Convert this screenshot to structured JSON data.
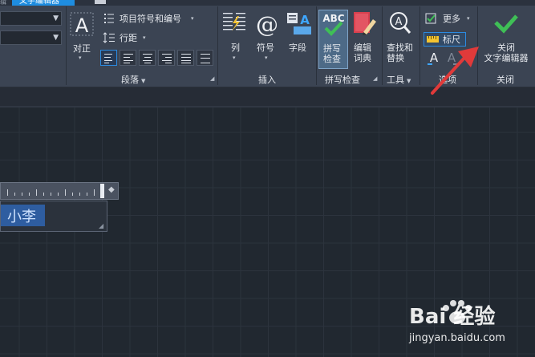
{
  "tabs": {
    "left_partial": "辑",
    "active": "文字编辑器"
  },
  "paragraph": {
    "justify_label": "对正",
    "bullets_label": "项目符号和编号",
    "line_spacing_label": "行距",
    "group_label": "段落"
  },
  "insert": {
    "columns_label": "列",
    "symbol_label": "符号",
    "field_label": "字段",
    "group_label": "插入"
  },
  "spellcheck": {
    "spell_label": "拼写\n检查",
    "spell_icon_text": "ABC",
    "dict_label": "编辑\n词典",
    "group_label": "拼写检查"
  },
  "tools": {
    "find_label": "查找和\n替换",
    "group_label": "工具"
  },
  "options": {
    "more_label": "更多",
    "ruler_label": "标尺",
    "group_label": "选项"
  },
  "close": {
    "close_label": "关闭\n文字编辑器",
    "group_label": "关闭"
  },
  "editor": {
    "text": "小李"
  },
  "watermark": {
    "brand": "Bai 经验",
    "url": "jingyan.baidu.com"
  },
  "colors": {
    "ribbon_bg": "#3b4453",
    "canvas_bg": "#212830",
    "accent": "#1e8de0",
    "check_green": "#3fbf56",
    "arrow_red": "#e03a3a"
  }
}
